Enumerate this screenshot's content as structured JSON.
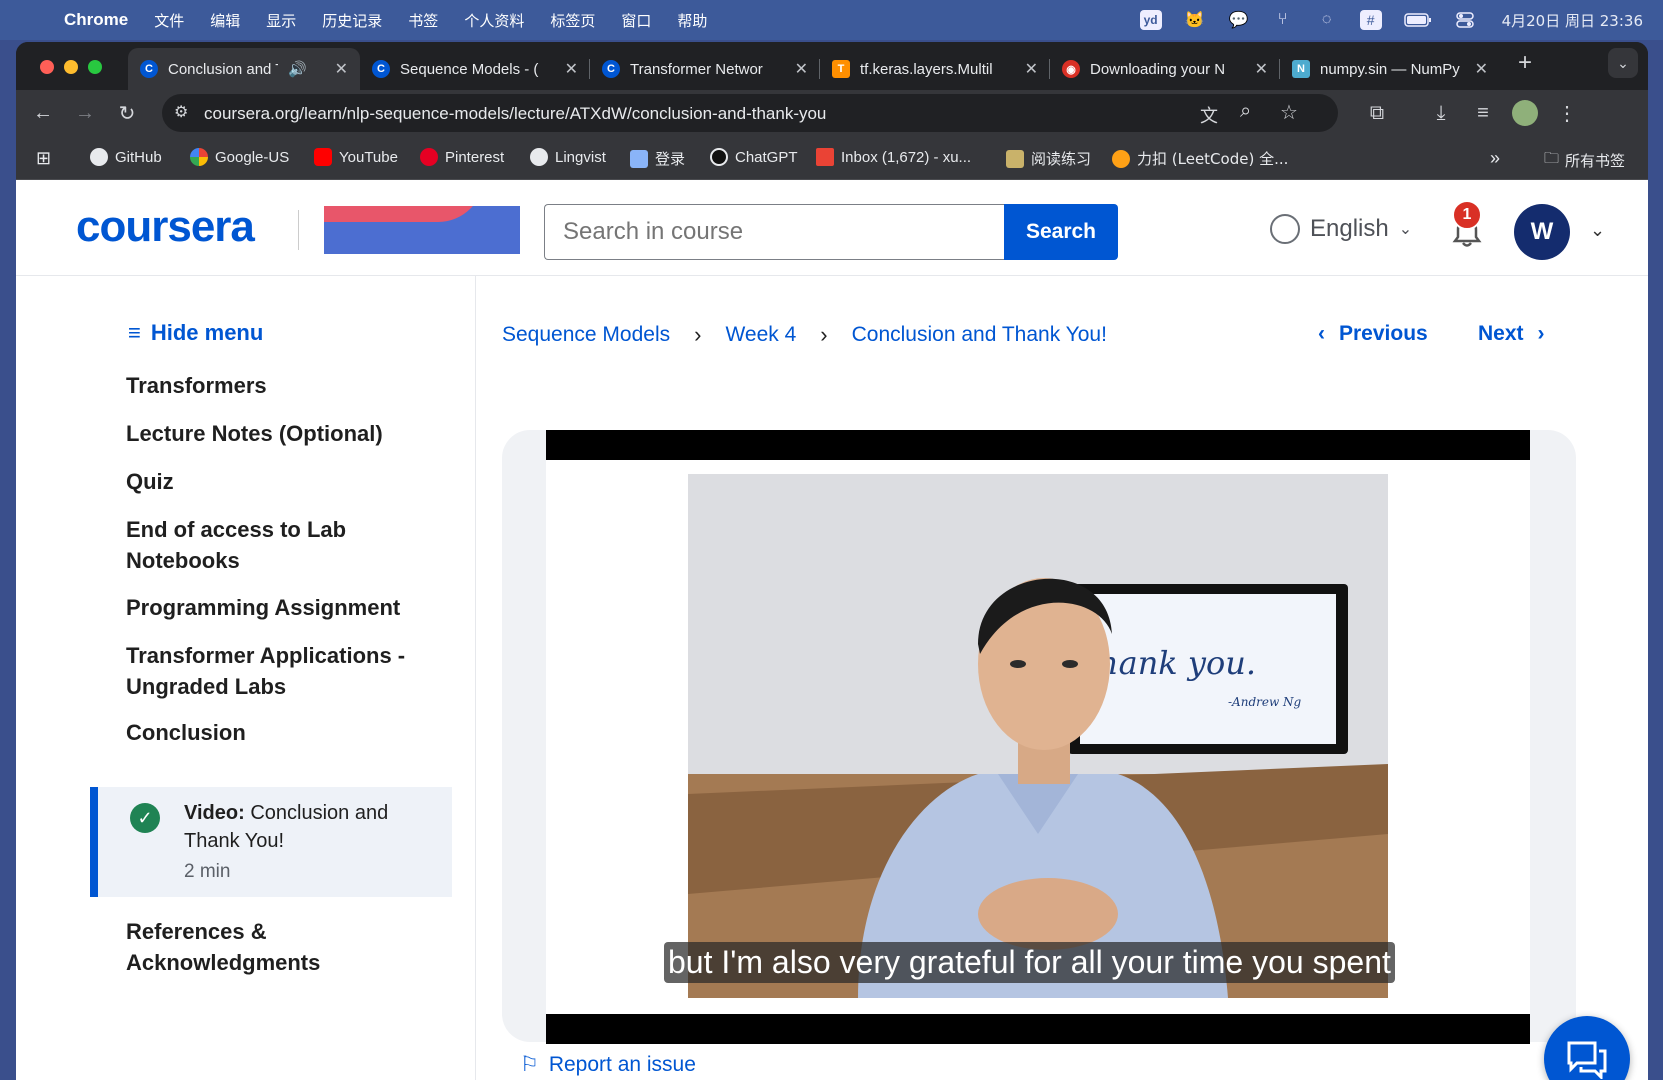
{
  "menubar": {
    "app": "Chrome",
    "items": [
      "文件",
      "编辑",
      "显示",
      "历史记录",
      "书签",
      "个人资料",
      "标签页",
      "窗口",
      "帮助"
    ],
    "clock": "4月20日 周日  23:36"
  },
  "tabs": [
    {
      "title": "Conclusion and T",
      "active": true
    },
    {
      "title": "Sequence Models - (",
      "active": false
    },
    {
      "title": "Transformer Networ",
      "active": false
    },
    {
      "title": "tf.keras.layers.Multil",
      "active": false
    },
    {
      "title": "Downloading your N",
      "active": false
    },
    {
      "title": "numpy.sin — NumPy",
      "active": false
    }
  ],
  "address": {
    "url": "coursera.org/learn/nlp-sequence-models/lecture/ATXdW/conclusion-and-thank-you"
  },
  "bookmarks": [
    "GitHub",
    "Google-US",
    "YouTube",
    "Pinterest",
    "Lingvist",
    "登录",
    "ChatGPT",
    "Inbox (1,672) - xu...",
    "阅读练习",
    "力扣 (LeetCode) 全...",
    "所有书签"
  ],
  "header": {
    "logo": "coursera",
    "search_placeholder": "Search in course",
    "search_button": "Search",
    "language": "English",
    "notification_count": "1",
    "avatar_initial": "W"
  },
  "sidebar": {
    "hide_menu": "Hide menu",
    "items": [
      "Transformers",
      "Lecture Notes (Optional)",
      "Quiz",
      "End of access to Lab Notebooks",
      "Programming Assignment",
      "Transformer Applications - Ungraded Labs",
      "Conclusion",
      "References & Acknowledgments"
    ],
    "active": {
      "type": "Video:",
      "title": "Conclusion and Thank You!",
      "duration": "2 min",
      "completed": true
    }
  },
  "breadcrumb": {
    "course": "Sequence Models",
    "week": "Week 4",
    "lecture": "Conclusion and Thank You!"
  },
  "nav": {
    "previous": "Previous",
    "next": "Next"
  },
  "video": {
    "subtitle": "but I'm also very grateful for all your time you spent",
    "screen_text": "hank you.",
    "screen_signature": "-Andrew Ng"
  },
  "report_issue": "Report an issue",
  "colors": {
    "accent": "#0056d2",
    "success": "#1f8354",
    "badge": "#d93025"
  }
}
